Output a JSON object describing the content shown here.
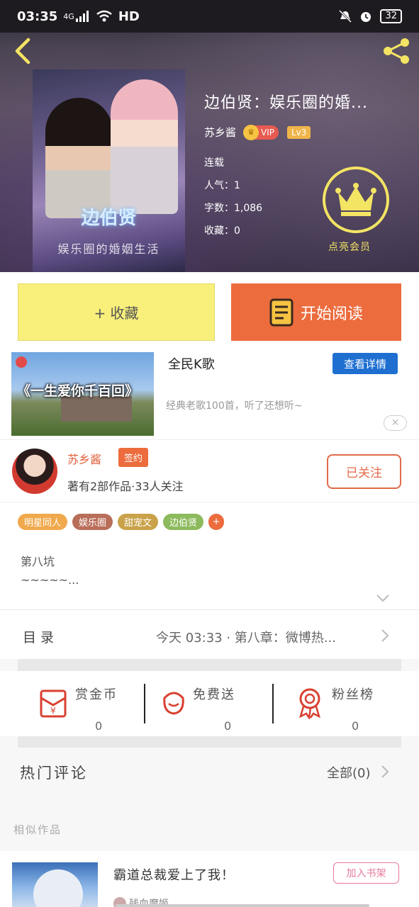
{
  "status_bar": {
    "time": "03:35",
    "network": "4G",
    "hd": "HD",
    "battery": "32"
  },
  "book": {
    "title": "边伯贤：娱乐圈的婚...",
    "cover_title": "边伯贤",
    "cover_subtitle": "娱乐圈的婚姻生活",
    "author": "苏乡酱",
    "vip_label": "VIP",
    "level": "Lv3",
    "status": "连载",
    "popularity": "人气：1",
    "word_count": "字数：1,086",
    "favorites": "收藏：0"
  },
  "member": {
    "label": "点亮会员"
  },
  "actions": {
    "collect_label": "+ 收藏",
    "read_label": "开始阅读"
  },
  "ad": {
    "image_text": "《一生爱你千百回》",
    "name": "全民K歌",
    "detail_label": "查看详情",
    "description": "经典老歌100首，听了还想听~"
  },
  "author_info": {
    "name": "苏乡酱",
    "signed_label": "签约",
    "stats": "著有2部作品·33人关注",
    "follow_label": "已关注"
  },
  "tags": [
    {
      "label": "明星同人",
      "color": "#f0a94c"
    },
    {
      "label": "娱乐圈",
      "color": "#b96e5a"
    },
    {
      "label": "甜宠文",
      "color": "#c9a24a"
    },
    {
      "label": "边伯贤",
      "color": "#8cba5c"
    },
    {
      "label": "+",
      "color": "#ec6c3e"
    }
  ],
  "intro": {
    "line1": "第八坑",
    "line2": "~~~~~..."
  },
  "catalog": {
    "label": "目录",
    "latest": "今天 03:33 · 第八章：微博热..."
  },
  "stats": {
    "reward_label": "赏金币",
    "reward_value": "0",
    "gift_label": "免费送",
    "gift_value": "0",
    "fans_label": "粉丝榜",
    "fans_value": "0"
  },
  "comments": {
    "title": "热门评论",
    "all_label": "全部(0)"
  },
  "similar": {
    "section_title": "相似作品",
    "title": "霸道总裁爱上了我！",
    "author": "残血魔姬",
    "add_label": "加入书架"
  },
  "colors": {
    "accent": "#ec6c3e",
    "collect_bg": "#f9f07b",
    "member_gold": "#f3e464",
    "detail_blue": "#1f6fd1"
  }
}
